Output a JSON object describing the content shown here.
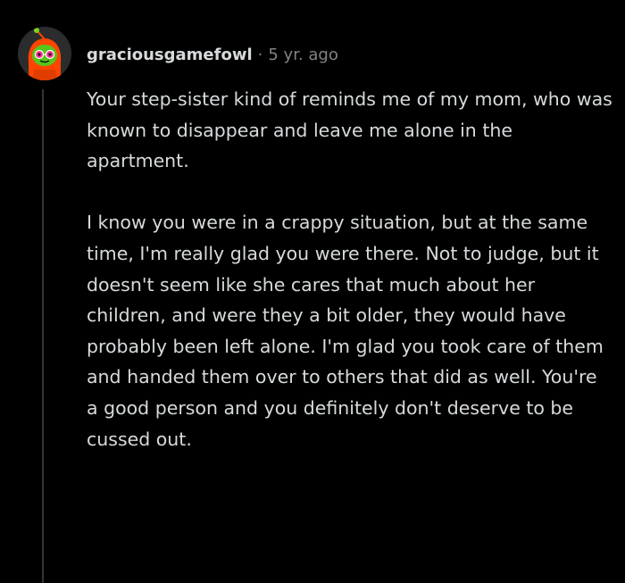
{
  "comment": {
    "author": "graciousgamefowl",
    "separator": "·",
    "timestamp": "5 yr. ago",
    "avatar_icon": "snoo-avatar-icon",
    "paragraphs": [
      "Your step-sister kind of reminds me of my mom, who was known to disappear and leave me alone in the apartment.",
      "I know you were in a crappy situation, but at the same time, I'm really glad you were there. Not to judge, but it doesn't seem like she cares that much about her children, and were they a bit older, they would have probably been left alone. I'm glad you took care of them and handed them over to others that did as well. You're a good person and you definitely don't deserve to be cussed out."
    ]
  },
  "colors": {
    "background": "#000000",
    "text": "#d7dadc",
    "meta": "#818384",
    "thread_line": "#343536",
    "avatar_hood": "#ff4500",
    "avatar_face": "#55c61b"
  }
}
